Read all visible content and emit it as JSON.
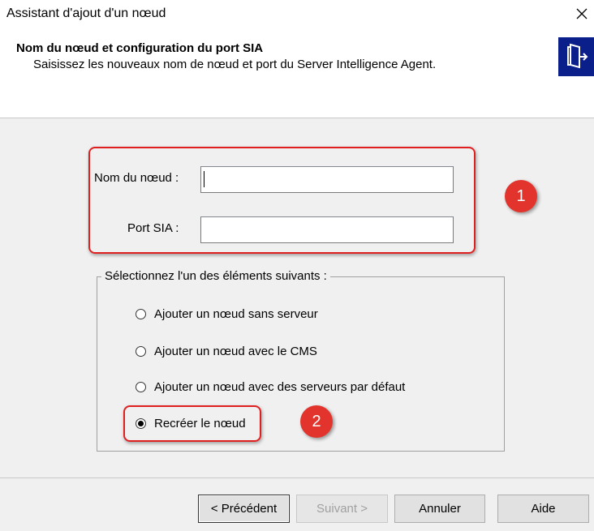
{
  "window": {
    "title": "Assistant d'ajout d'un nœud"
  },
  "header": {
    "step_title": "Nom du nœud et configuration du port SIA",
    "step_subtitle": "Saisissez les nouveaux nom de nœud et port du Server Intelligence Agent."
  },
  "fields": {
    "node_name": {
      "label": "Nom du nœud :",
      "value": ""
    },
    "sia_port": {
      "label": "Port SIA :",
      "value": ""
    }
  },
  "options": {
    "legend": "Sélectionnez l'un des éléments suivants :",
    "items": [
      {
        "label": "Ajouter un nœud sans serveur",
        "checked": false
      },
      {
        "label": "Ajouter un nœud avec le CMS",
        "checked": false
      },
      {
        "label": "Ajouter un nœud avec des serveurs par défaut",
        "checked": false
      },
      {
        "label": "Recréer le nœud",
        "checked": true
      }
    ]
  },
  "callouts": {
    "first": "1",
    "second": "2"
  },
  "buttons": {
    "previous": "< Précédent",
    "next": "Suivant >",
    "cancel": "Annuler",
    "help": "Aide"
  },
  "colors": {
    "highlight": "#e02020",
    "callout": "#e2342d",
    "icon_bg": "#0b1f8a"
  }
}
